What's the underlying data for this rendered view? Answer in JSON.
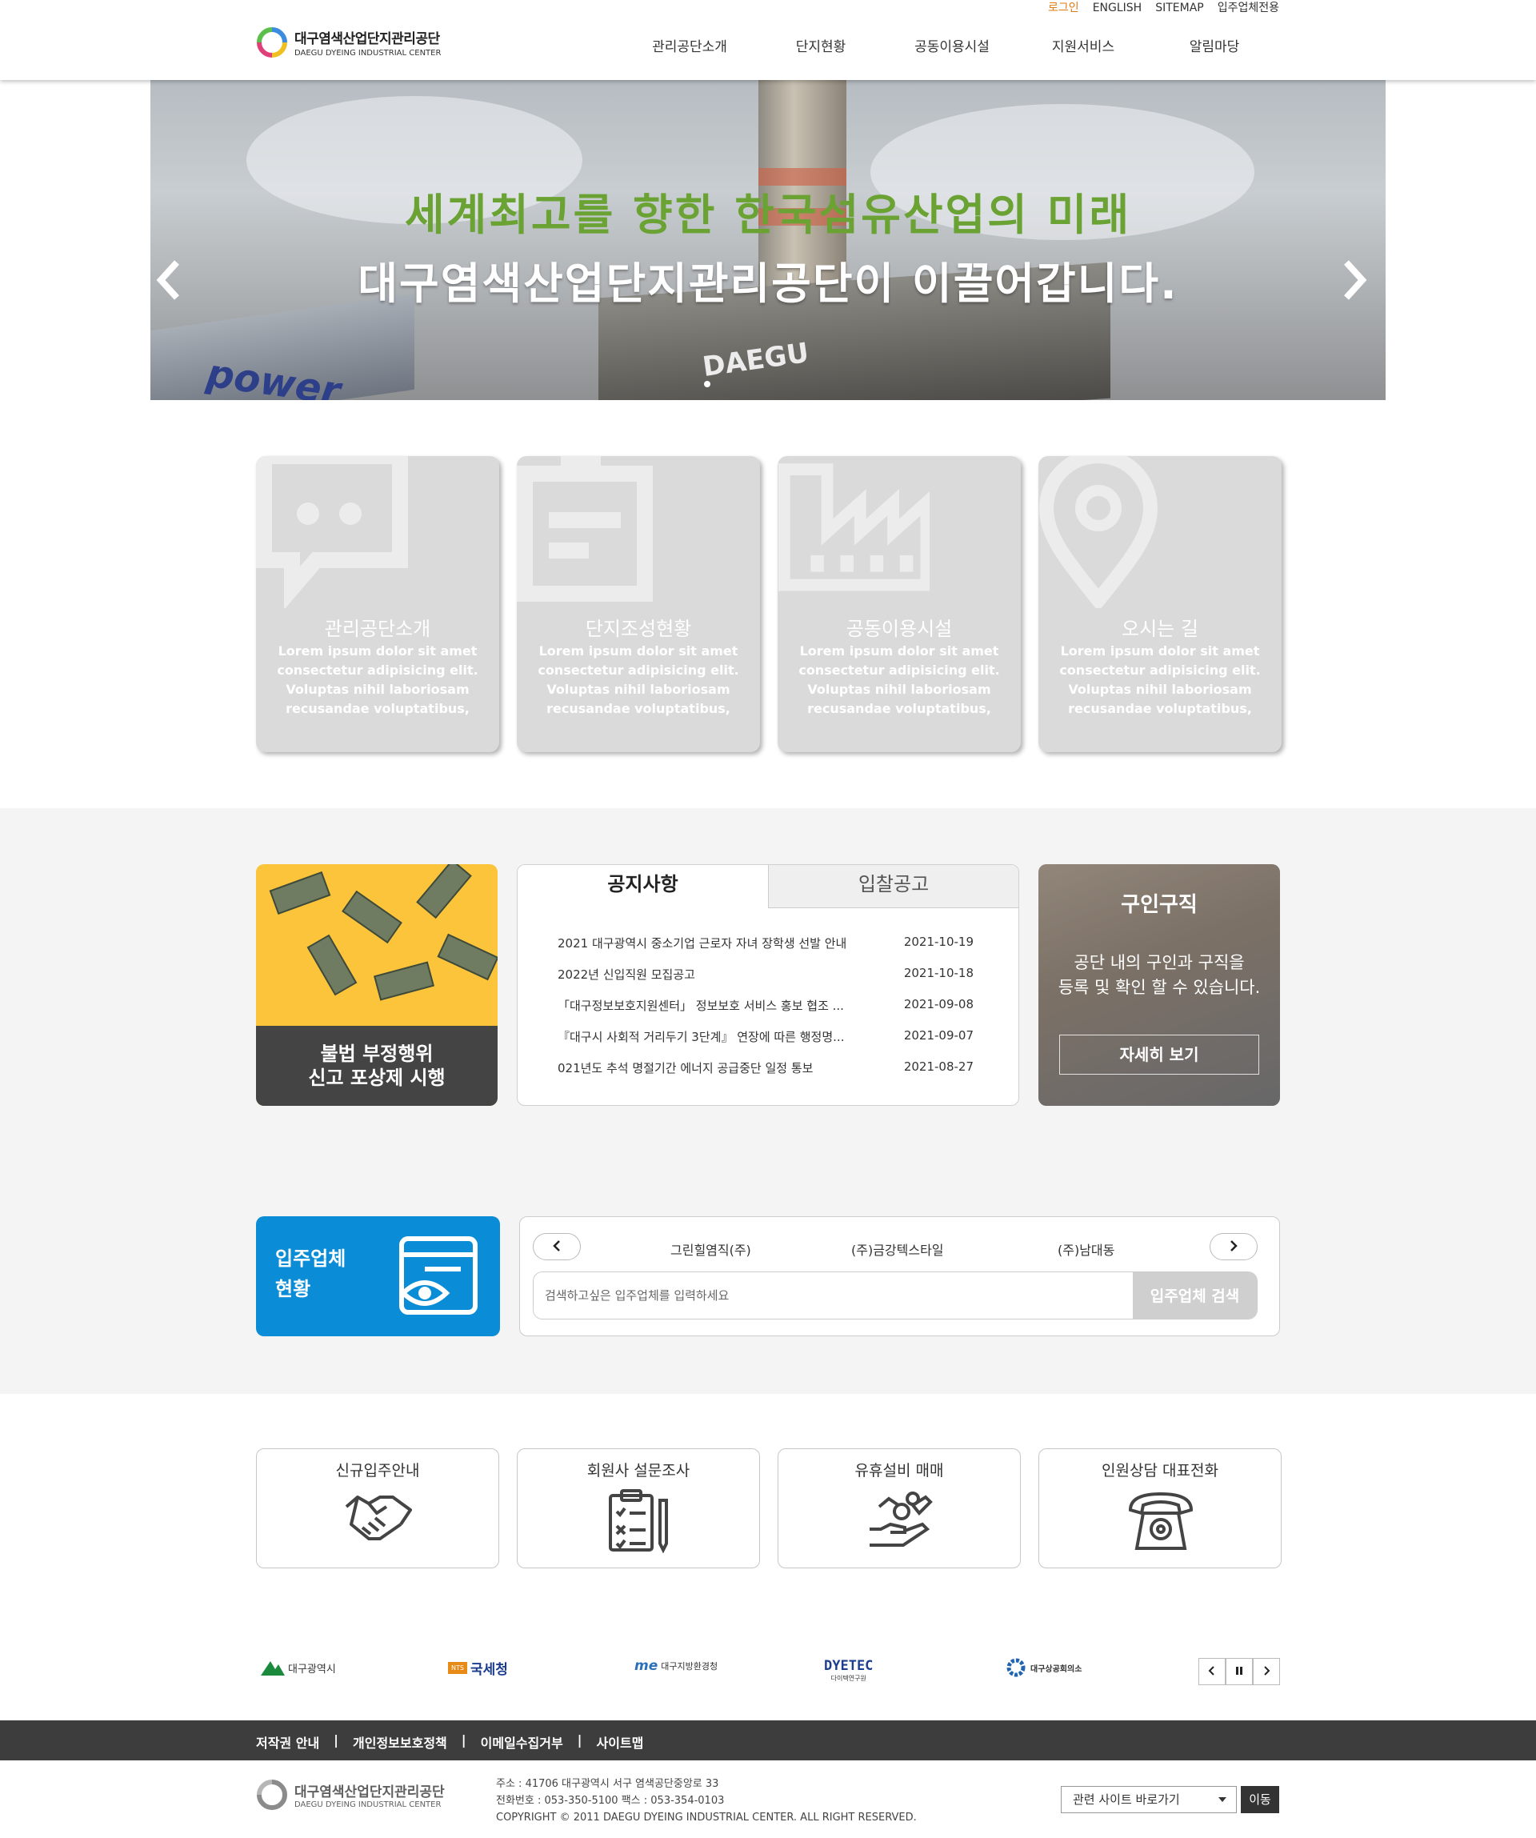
{
  "header": {
    "util_links": [
      "로그인",
      "ENGLISH",
      "SITEMAP",
      "입주업체전용"
    ],
    "logo_ko": "대구염색산업단지관리공단",
    "logo_en": "DAEGU DYEING INDUSTRIAL CENTER",
    "nav": [
      "관리공단소개",
      "단지현황",
      "공동이용시설",
      "지원서비스",
      "알림마당"
    ]
  },
  "hero": {
    "line1": "세계최고를 향한 한국섬유산업의 미래",
    "line2": "대구염색산업단지관리공단이 이끌어갑니다.",
    "bg_sign_left": "power",
    "bg_sign_right": "DAEGU",
    "prev_icon": "chevron-left-icon",
    "next_icon": "chevron-right-icon"
  },
  "quick_cards": [
    {
      "title": "관리공단소개",
      "desc": "Lorem ipsum dolor sit amet consectetur adipisicing elit. Voluptas nihil laboriosam recusandae voluptatibus,",
      "icon": "chat-icon"
    },
    {
      "title": "단지조성현황",
      "desc": "Lorem ipsum dolor sit amet consectetur adipisicing elit. Voluptas nihil laboriosam recusandae voluptatibus,",
      "icon": "clipboard-icon"
    },
    {
      "title": "공동이용시설",
      "desc": "Lorem ipsum dolor sit amet consectetur adipisicing elit. Voluptas nihil laboriosam recusandae voluptatibus,",
      "icon": "factory-icon"
    },
    {
      "title": "오시는 길",
      "desc": "Lorem ipsum dolor sit amet consectetur adipisicing elit. Voluptas nihil laboriosam recusandae voluptatibus,",
      "icon": "map-pin-icon"
    }
  ],
  "promo": {
    "line1": "불법 부정행위",
    "line2": "신고 포상제 시행"
  },
  "notice": {
    "tabs": [
      "공지사항",
      "입찰공고"
    ],
    "items": [
      {
        "title": "2021 대구광역시 중소기업 근로자 자녀 장학생 선발 안내",
        "date": "2021-10-19"
      },
      {
        "title": "2022년 신입직원 모집공고",
        "date": "2021-10-18"
      },
      {
        "title": "「대구정보보호지원센터」 정보보호 서비스 홍보 협조 ...",
        "date": "2021-09-08"
      },
      {
        "title": "『대구시 사회적 거리두기 3단계』 연장에 따른 행정명...",
        "date": "2021-09-07"
      },
      {
        "title": "021년도 추석 명절기간 에너지 공급중단 일정 통보",
        "date": "2021-08-27"
      }
    ]
  },
  "jobs": {
    "title": "구인구직",
    "desc1": "공단 내의 구인과 구직을",
    "desc2": "등록 및 확인 할 수 있습니다.",
    "button": "자세히 보기"
  },
  "tenant": {
    "label1": "입주업체",
    "label2": "현황",
    "companies": [
      "그린힐염직(주)",
      "(주)금강텍스타일",
      "(주)남대동"
    ],
    "search_placeholder": "검색하고싶은 입주업체를 입력하세요",
    "search_button": "입주업체 검색"
  },
  "services": [
    {
      "title": "신규입주안내",
      "icon": "handshake-icon"
    },
    {
      "title": "회원사 설문조사",
      "icon": "survey-clipboard-icon"
    },
    {
      "title": "유휴설비 매매",
      "icon": "hand-coins-icon"
    },
    {
      "title": "인원상담 대표전화",
      "icon": "telephone-icon"
    }
  ],
  "related_sites": [
    {
      "name": "대구광역시",
      "mark": "DAEGU",
      "color": "#1c8a3c"
    },
    {
      "name": "국세청",
      "mark": "NTS",
      "color": "#e88a17"
    },
    {
      "name": "대구지방환경청",
      "mark": "me",
      "color": "#2a70b8"
    },
    {
      "name": "다이텍연구원",
      "mark": "DYETEC",
      "color": "#1e3f8f"
    },
    {
      "name": "대구상공회의소",
      "mark": "",
      "color": "#1f64b0"
    }
  ],
  "footer": {
    "links": [
      "저작권 안내",
      "개인정보보호정책",
      "이메일수집거부",
      "사이트맵"
    ],
    "separator": "|",
    "address": "주소 : 41706 대구광역시 서구 염색공단중앙로 33",
    "phone": "전화번호 : 053-350-5100 팩스 : 053-354-0103",
    "copyright": "COPYRIGHT © 2011 DAEGU DYEING INDUSTRIAL CENTER. ALL RIGHT RESERVED.",
    "select_label": "관련 사이트 바로가기",
    "go_button": "이동"
  },
  "colors": {
    "accent_orange": "#e07b14",
    "hero_green": "#6aa333",
    "tenant_blue": "#0a8dd6",
    "promo_yellow": "#fcc43a",
    "footer_bar": "#3d3d3d"
  }
}
